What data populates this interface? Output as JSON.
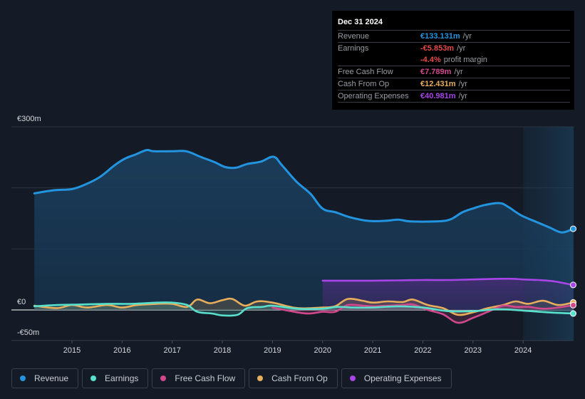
{
  "tooltip": {
    "date": "Dec 31 2024",
    "rows": [
      {
        "label": "Revenue",
        "value": "€133.131m",
        "unit": "/yr",
        "color": "#2394df"
      },
      {
        "label": "Earnings",
        "value": "-€5.853m",
        "unit": "/yr",
        "color": "#e64848"
      },
      {
        "label": "",
        "value": "-4.4%",
        "unit": "profit margin",
        "color": "#e64848"
      },
      {
        "label": "Free Cash Flow",
        "value": "€7.789m",
        "unit": "/yr",
        "color": "#d1488d"
      },
      {
        "label": "Cash From Op",
        "value": "€12.431m",
        "unit": "/yr",
        "color": "#e8ae5b"
      },
      {
        "label": "Operating Expenses",
        "value": "€40.981m",
        "unit": "/yr",
        "color": "#a745e6"
      }
    ]
  },
  "legend": [
    {
      "label": "Revenue",
      "color": "#2394df"
    },
    {
      "label": "Earnings",
      "color": "#58e0cc"
    },
    {
      "label": "Free Cash Flow",
      "color": "#d1488d"
    },
    {
      "label": "Cash From Op",
      "color": "#e8ae5b"
    },
    {
      "label": "Operating Expenses",
      "color": "#a745e6"
    }
  ],
  "chart_data": {
    "type": "area",
    "title": "",
    "xlabel": "",
    "ylabel": "",
    "x_range": [
      2014.25,
      2025.0
    ],
    "ylim": [
      -50,
      300
    ],
    "y_ticks": [
      {
        "value": 300,
        "label": "€300m"
      },
      {
        "value": 0,
        "label": "€0"
      },
      {
        "value": -50,
        "label": "-€50m"
      }
    ],
    "x_ticks": [
      "2015",
      "2016",
      "2017",
      "2018",
      "2019",
      "2020",
      "2021",
      "2022",
      "2023",
      "2024"
    ],
    "x_tick_values": [
      2015,
      2016,
      2017,
      2018,
      2019,
      2020,
      2021,
      2022,
      2023,
      2024
    ],
    "gridlines": [
      300,
      200,
      100,
      0
    ],
    "highlight_from": 2024.0,
    "unit": "€m",
    "series": [
      {
        "name": "Revenue",
        "color": "#2394df",
        "x": [
          2014.25,
          2014.63,
          2015.0,
          2015.28,
          2015.56,
          2015.85,
          2016.06,
          2016.28,
          2016.49,
          2016.63,
          2016.99,
          2017.28,
          2017.56,
          2017.85,
          2018.06,
          2018.27,
          2018.49,
          2018.77,
          2019.02,
          2019.19,
          2019.48,
          2019.76,
          2020.0,
          2020.26,
          2020.54,
          2020.9,
          2021.25,
          2021.51,
          2021.75,
          2022.25,
          2022.54,
          2022.79,
          2023.03,
          2023.24,
          2023.53,
          2023.7,
          2023.96,
          2024.27,
          2024.53,
          2024.77,
          2025.0
        ],
        "values": [
          191,
          196,
          198,
          206,
          218,
          237,
          248,
          255,
          262,
          260,
          260,
          260,
          251,
          242,
          234,
          233,
          239,
          243,
          251,
          237,
          210,
          190,
          166,
          160,
          152,
          146,
          146,
          148,
          145,
          145,
          148,
          160,
          167,
          172,
          175,
          169,
          155,
          144,
          135,
          127,
          133
        ]
      },
      {
        "name": "Earnings",
        "color": "#58e0cc",
        "x": [
          2014.25,
          2014.7,
          2015.2,
          2015.7,
          2016.2,
          2016.7,
          2017.0,
          2017.3,
          2017.5,
          2017.8,
          2018.0,
          2018.3,
          2018.5,
          2018.8,
          2019.0,
          2019.5,
          2020.0,
          2020.3,
          2020.6,
          2021.0,
          2021.5,
          2022.0,
          2022.5,
          2023.0,
          2023.5,
          2024.0,
          2024.5,
          2025.0
        ],
        "values": [
          6,
          8,
          9,
          10,
          10,
          12,
          12,
          8,
          -3,
          -6,
          -9,
          -8,
          3,
          5,
          7,
          2,
          2,
          5,
          4,
          4,
          6,
          4,
          -2,
          -2,
          1,
          -1,
          -4,
          -5.853
        ]
      },
      {
        "name": "Free Cash Flow",
        "color": "#d1488d",
        "x": [
          2019.0,
          2019.3,
          2019.7,
          2020.0,
          2020.25,
          2020.5,
          2020.8,
          2021.0,
          2021.3,
          2021.6,
          2021.8,
          2022.1,
          2022.4,
          2022.7,
          2023.0,
          2023.3,
          2023.6,
          2023.85,
          2024.1,
          2024.4,
          2024.7,
          2025.0
        ],
        "values": [
          4,
          -1,
          -6,
          -3,
          -3,
          8,
          7,
          6,
          7,
          8,
          9,
          0,
          -7,
          -21,
          -13,
          -3,
          7,
          5,
          5,
          2,
          4,
          7.789
        ]
      },
      {
        "name": "Cash From Op",
        "color": "#e8ae5b",
        "x": [
          2014.25,
          2014.7,
          2015.0,
          2015.3,
          2015.7,
          2016.0,
          2016.3,
          2016.7,
          2017.0,
          2017.3,
          2017.5,
          2017.75,
          2018.0,
          2018.2,
          2018.45,
          2018.7,
          2019.0,
          2019.5,
          2020.0,
          2020.25,
          2020.5,
          2020.8,
          2021.0,
          2021.3,
          2021.6,
          2021.8,
          2022.1,
          2022.4,
          2022.7,
          2023.0,
          2023.3,
          2023.6,
          2023.85,
          2024.1,
          2024.4,
          2024.7,
          2025.0
        ],
        "values": [
          7,
          3,
          8,
          4,
          8,
          4,
          8,
          10,
          10,
          5,
          17,
          11,
          16,
          18,
          7,
          14,
          12,
          3,
          4,
          6,
          18,
          15,
          12,
          14,
          13,
          17,
          8,
          3,
          -8,
          -4,
          3,
          8,
          14,
          10,
          15,
          8,
          12.431
        ]
      },
      {
        "name": "Operating Expenses",
        "color": "#a745e6",
        "x": [
          2020.0,
          2020.5,
          2021.0,
          2021.5,
          2022.0,
          2022.5,
          2023.0,
          2023.5,
          2023.8,
          2024.0,
          2024.3,
          2024.6,
          2025.0
        ],
        "values": [
          48,
          48,
          48,
          48.5,
          49,
          49,
          50,
          51,
          51,
          50,
          49,
          47,
          40.981
        ]
      }
    ]
  }
}
